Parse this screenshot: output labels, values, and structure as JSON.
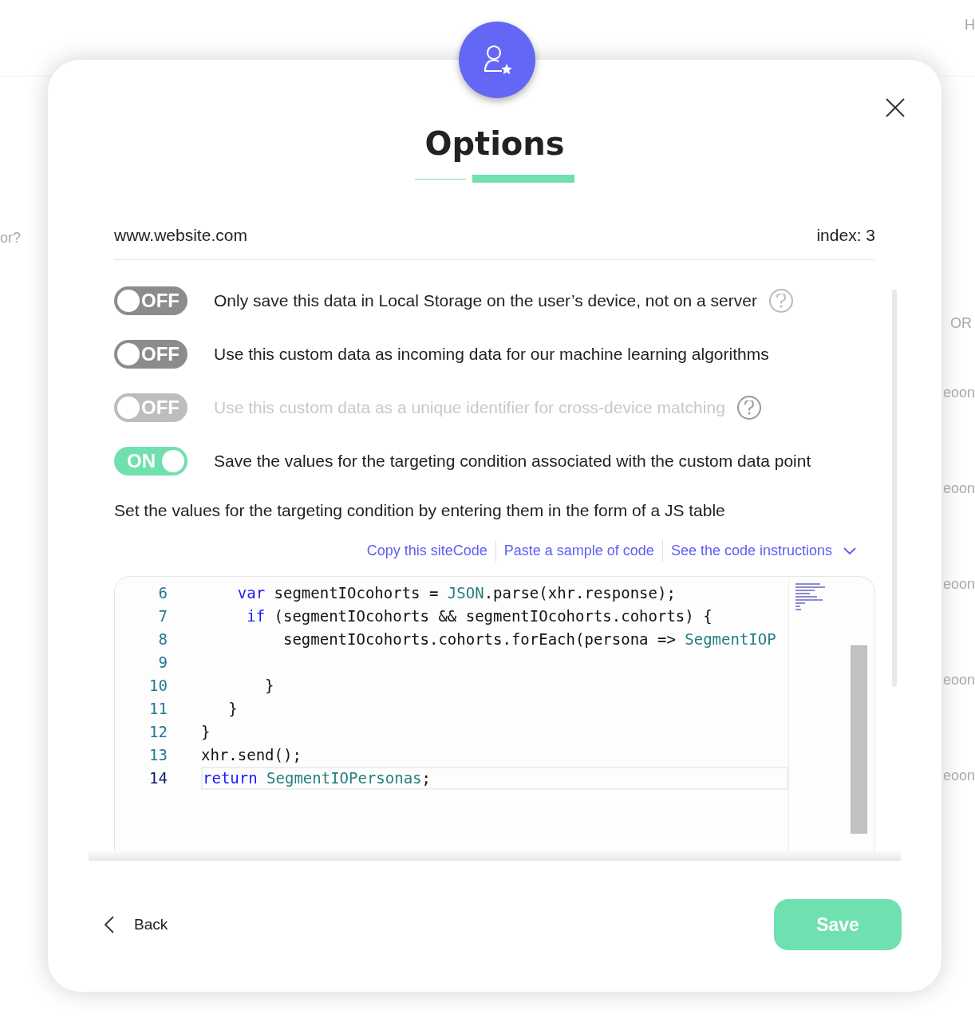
{
  "background": [
    "H",
    "or?",
    "OR",
    "eoon",
    "eoon",
    "eoon",
    "eoon",
    "eoon"
  ],
  "dialog": {
    "title": "Options",
    "site": "www.website.com",
    "index": "index: 3"
  },
  "options": [
    {
      "on": false,
      "disabled": false,
      "state_label": "OFF",
      "text": "Only save this data in Local Storage on the user’s device, not on a server",
      "hint": true
    },
    {
      "on": false,
      "disabled": false,
      "state_label": "OFF",
      "text": "Use this custom data as incoming data for our machine learning algorithms",
      "hint": false
    },
    {
      "on": false,
      "disabled": true,
      "state_label": "OFF",
      "text": "Use this custom data as a unique identifier for cross-device matching",
      "hint": true
    },
    {
      "on": true,
      "disabled": false,
      "state_label": "ON",
      "text": "Save the values for the targeting condition associated with the custom data point",
      "hint": false
    }
  ],
  "instructions": "Set the values for the targeting condition by entering them in the form of a JS table",
  "links": [
    {
      "label": "Copy this siteCode",
      "caret": false
    },
    {
      "label": "Paste a sample of code",
      "caret": false
    },
    {
      "label": "See the code instructions",
      "caret": true
    }
  ],
  "code": [
    {
      "number": "6",
      "current": false,
      "tokens": [
        {
          "kind": "keyword",
          "text": "    var"
        },
        {
          "kind": "plain",
          "text": " segmentIOcohorts = "
        },
        {
          "kind": "type",
          "text": "JSON"
        },
        {
          "kind": "plain",
          "text": ".parse(xhr.response);"
        }
      ]
    },
    {
      "number": "7",
      "current": false,
      "tokens": [
        {
          "kind": "keyword",
          "text": "     if"
        },
        {
          "kind": "plain",
          "text": " (segmentIOcohorts && segmentIOcohorts.cohorts) {"
        }
      ]
    },
    {
      "number": "8",
      "current": false,
      "tokens": [
        {
          "kind": "plain",
          "text": "         segmentIOcohorts.cohorts.forEach(persona => "
        },
        {
          "kind": "type",
          "text": "SegmentIOP"
        }
      ]
    },
    {
      "number": "9",
      "current": false
    },
    {
      "number": "10",
      "current": false,
      "tokens": [
        {
          "kind": "plain",
          "text": "       }"
        }
      ]
    },
    {
      "number": "11",
      "current": false,
      "tokens": [
        {
          "kind": "plain",
          "text": "   }"
        }
      ]
    },
    {
      "number": "12",
      "current": false,
      "tokens": [
        {
          "kind": "plain",
          "text": "}"
        }
      ]
    },
    {
      "number": "13",
      "current": false,
      "tokens": [
        {
          "kind": "plain",
          "text": "xhr.send();"
        }
      ]
    },
    {
      "number": "14",
      "current": true,
      "tokens": [
        {
          "kind": "keyword",
          "text": "return"
        },
        {
          "kind": "type",
          "text": " SegmentIOPersonas"
        },
        {
          "kind": "plain",
          "text": ";"
        }
      ]
    }
  ],
  "footer": {
    "back": "Back",
    "save": "Save"
  }
}
